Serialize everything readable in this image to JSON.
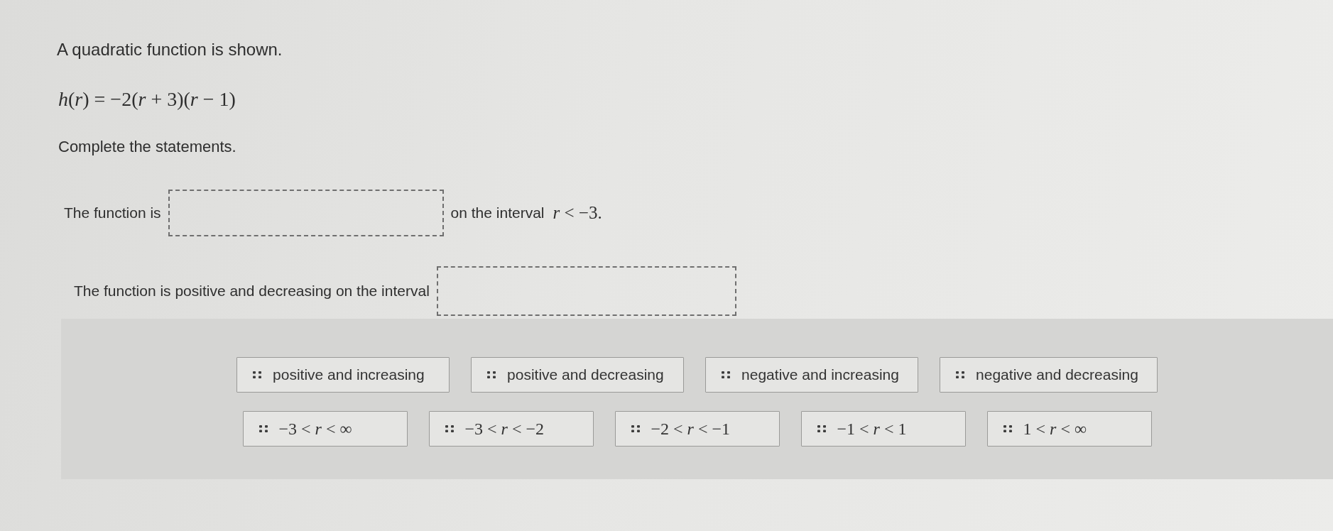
{
  "question": {
    "intro": "A quadratic function is shown.",
    "equation": "*h*(*r*) = −2(*r* + 3)(*r* − 1)",
    "instruction": "Complete the statements."
  },
  "statements": [
    {
      "text_before": "The function is",
      "text_after": "on the interval",
      "math_after": "*r* < −3."
    },
    {
      "text_before": "The function is positive and decreasing on the interval"
    }
  ],
  "answer_bank": {
    "rows": [
      {
        "tiles": [
          {
            "kind": "text",
            "label": "positive and increasing"
          },
          {
            "kind": "text",
            "label": "positive and decreasing"
          },
          {
            "kind": "text",
            "label": "negative and increasing"
          },
          {
            "kind": "text",
            "label": "negative and decreasing"
          }
        ]
      },
      {
        "tiles": [
          {
            "kind": "math",
            "label": "−3 < *r* < ∞"
          },
          {
            "kind": "math",
            "label": "−3 < *r* < −2"
          },
          {
            "kind": "math",
            "label": "−2 < *r* < −1"
          },
          {
            "kind": "math",
            "label": "−1 < *r* < 1"
          },
          {
            "kind": "math",
            "label": "1 < *r* < ∞"
          }
        ]
      }
    ]
  }
}
